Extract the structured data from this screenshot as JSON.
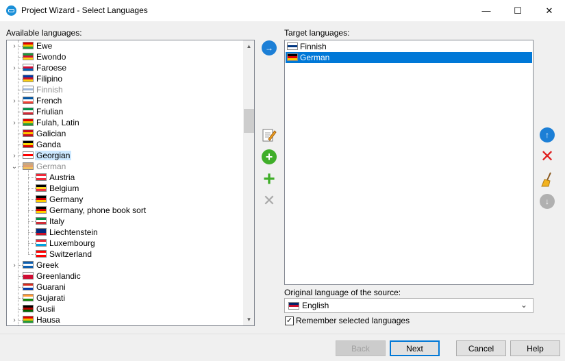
{
  "window": {
    "title": "Project Wizard - Select Languages"
  },
  "available": {
    "label": "Available languages:",
    "items": [
      {
        "text": "Ewe",
        "expandable": true,
        "colors": [
          "#e00000",
          "#f2c200",
          "#229d3a"
        ]
      },
      {
        "text": "Ewondo",
        "expandable": false,
        "colors": [
          "#1a9a3c",
          "#d21034",
          "#fcd116"
        ]
      },
      {
        "text": "Faroese",
        "expandable": true,
        "colors": [
          "#ffffff",
          "#d21034",
          "#0065bd"
        ]
      },
      {
        "text": "Filipino",
        "expandable": false,
        "colors": [
          "#0038a8",
          "#ce1126",
          "#fcd116"
        ]
      },
      {
        "text": "Finnish",
        "expandable": false,
        "disabled": true,
        "colors": [
          "#ffffff",
          "#9fb7d9",
          "#ffffff"
        ]
      },
      {
        "text": "French",
        "expandable": true,
        "colors": [
          "#0055a4",
          "#ffffff",
          "#ef4135"
        ]
      },
      {
        "text": "Friulian",
        "expandable": false,
        "colors": [
          "#009246",
          "#ffffff",
          "#ce2b37"
        ]
      },
      {
        "text": "Fulah, Latin",
        "expandable": true,
        "colors": [
          "#e00000",
          "#f2c200",
          "#229d3a"
        ]
      },
      {
        "text": "Galician",
        "expandable": false,
        "colors": [
          "#c60b1e",
          "#ffc400",
          "#c60b1e"
        ]
      },
      {
        "text": "Ganda",
        "expandable": false,
        "colors": [
          "#000000",
          "#fcdc04",
          "#d90000"
        ]
      },
      {
        "text": "Georgian",
        "expandable": true,
        "selected": true,
        "colors": [
          "#ffffff",
          "#ff0000",
          "#ffffff"
        ]
      },
      {
        "text": "German",
        "expanded": true,
        "disabled": true,
        "colors": [
          "#c8a882",
          "#e0a070",
          "#f0c060"
        ]
      },
      {
        "text": "Austria",
        "child": true,
        "colors": [
          "#ed2939",
          "#ffffff",
          "#ed2939"
        ]
      },
      {
        "text": "Belgium",
        "child": true,
        "colors": [
          "#000000",
          "#fdda24",
          "#ef3340"
        ]
      },
      {
        "text": "Germany",
        "child": true,
        "colors": [
          "#000000",
          "#dd0000",
          "#ffce00"
        ]
      },
      {
        "text": "Germany, phone book sort",
        "child": true,
        "colors": [
          "#000000",
          "#dd0000",
          "#ffce00"
        ]
      },
      {
        "text": "Italy",
        "child": true,
        "colors": [
          "#009246",
          "#ffffff",
          "#ce2b37"
        ]
      },
      {
        "text": "Liechtenstein",
        "child": true,
        "colors": [
          "#002b7f",
          "#002b7f",
          "#ce1126"
        ]
      },
      {
        "text": "Luxembourg",
        "child": true,
        "colors": [
          "#ed2939",
          "#ffffff",
          "#00a1de"
        ]
      },
      {
        "text": "Switzerland",
        "child": true,
        "colors": [
          "#ff0000",
          "#ffffff",
          "#ff0000"
        ]
      },
      {
        "text": "Greek",
        "expandable": true,
        "colors": [
          "#0d5eaf",
          "#ffffff",
          "#0d5eaf"
        ]
      },
      {
        "text": "Greenlandic",
        "expandable": false,
        "colors": [
          "#ffffff",
          "#d00c33",
          "#d00c33"
        ]
      },
      {
        "text": "Guarani",
        "expandable": false,
        "colors": [
          "#d52b1e",
          "#ffffff",
          "#0038a8"
        ]
      },
      {
        "text": "Gujarati",
        "expandable": false,
        "colors": [
          "#ff9933",
          "#ffffff",
          "#138808"
        ]
      },
      {
        "text": "Gusii",
        "expandable": false,
        "colors": [
          "#000000",
          "#bb0000",
          "#006600"
        ]
      },
      {
        "text": "Hausa",
        "expandable": true,
        "colors": [
          "#e00000",
          "#f2c200",
          "#229d3a"
        ]
      }
    ]
  },
  "target": {
    "label": "Target languages:",
    "items": [
      {
        "text": "Finnish",
        "selected": false,
        "colors": [
          "#ffffff",
          "#003580",
          "#ffffff"
        ]
      },
      {
        "text": "German",
        "selected": true,
        "colors": [
          "#000000",
          "#dd0000",
          "#ffce00"
        ]
      }
    ]
  },
  "source": {
    "label": "Original language of the source:",
    "value": "English",
    "colors": [
      "#012169",
      "#c8102e",
      "#ffffff"
    ]
  },
  "remember": {
    "label": "Remember selected languages",
    "checked": true,
    "check_glyph": "✓"
  },
  "buttons": {
    "back": "Back",
    "next": "Next",
    "cancel": "Cancel",
    "help": "Help"
  },
  "icons": {
    "arrow_right": "→",
    "up": "↑",
    "down": "↓",
    "delete": "✕",
    "add": "+",
    "chevron_right": "›",
    "chevron_down": "⌄",
    "combo_arrow": "⌄",
    "scroll_up": "▲",
    "scroll_down": "▼",
    "win_min": "—",
    "win_max": "☐",
    "win_close": "✕"
  }
}
